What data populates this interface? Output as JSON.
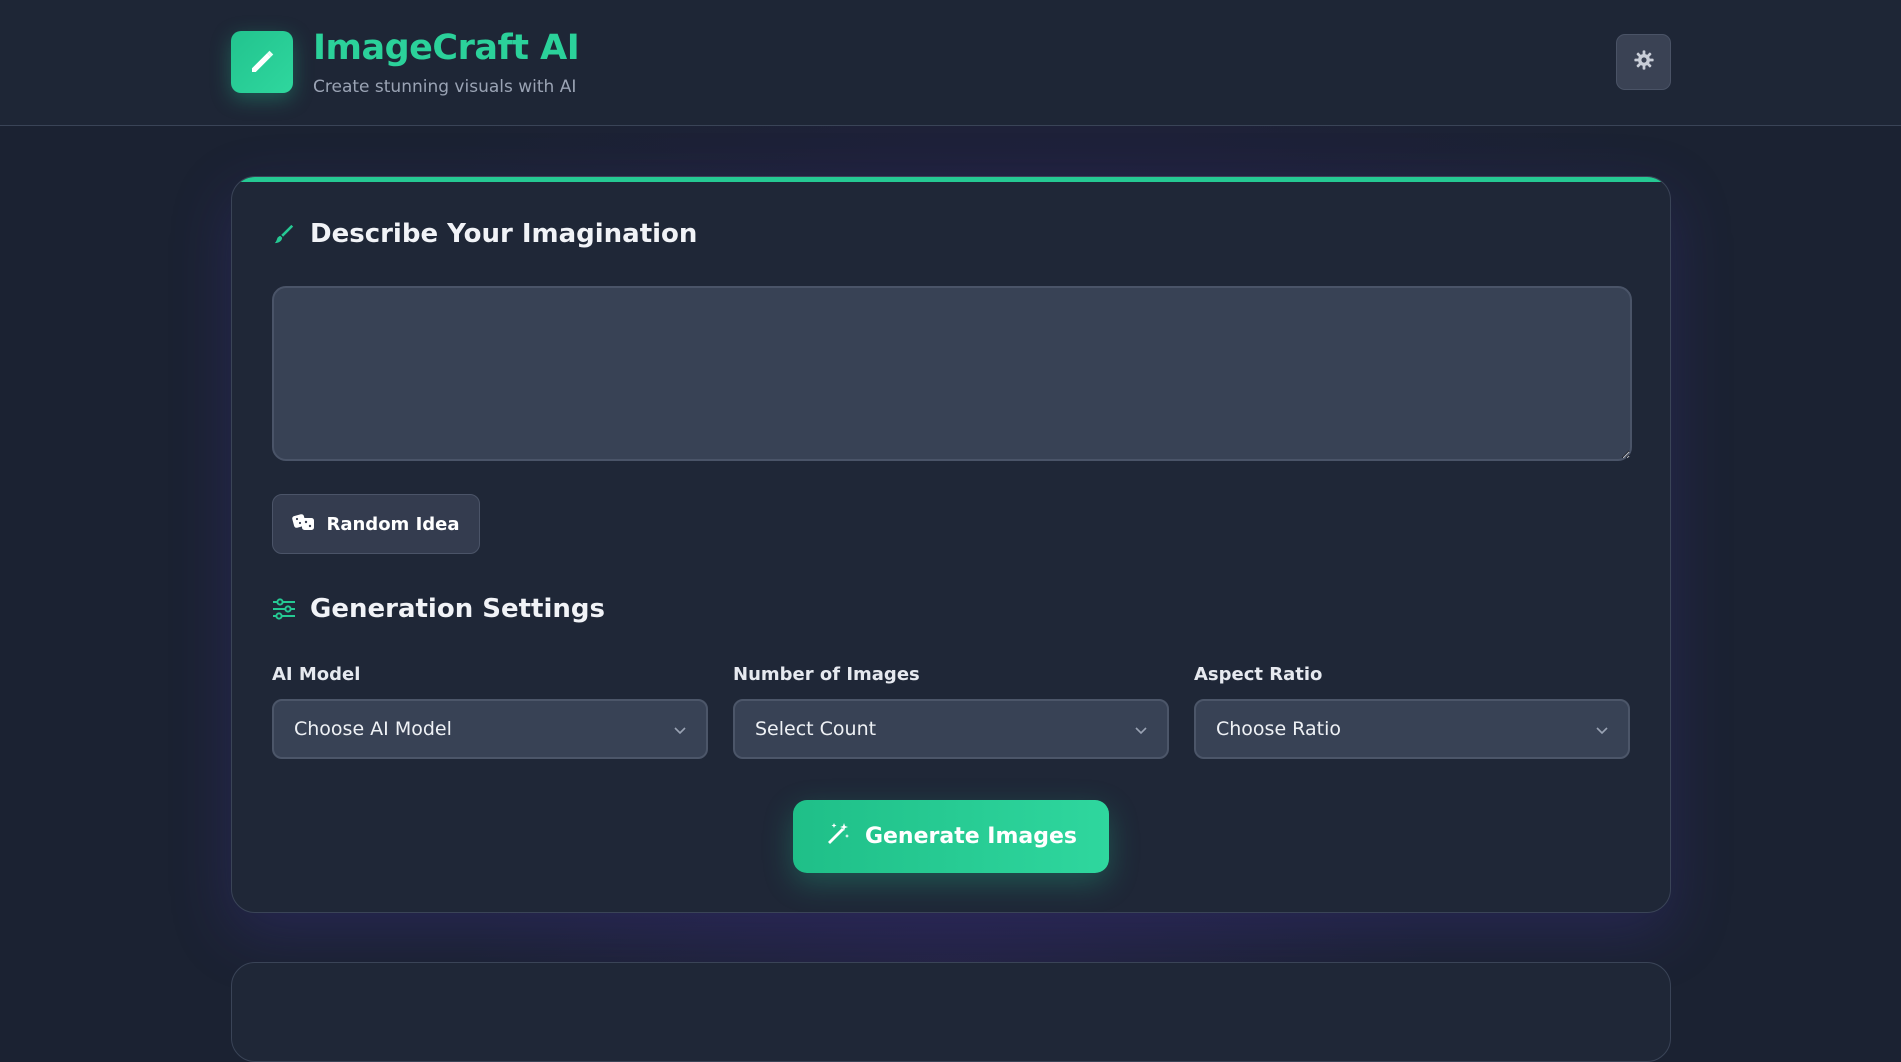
{
  "header": {
    "brand_title": "ImageCraft AI",
    "brand_subtitle": "Create stunning visuals with AI",
    "logo_icon": "brush-icon",
    "settings_icon": "gear-icon"
  },
  "prompt_section": {
    "title": "Describe Your Imagination",
    "icon": "paintbrush-icon",
    "textarea_value": "",
    "random_button_label": "Random Idea",
    "random_button_icon": "dice-icon"
  },
  "settings_section": {
    "title": "Generation Settings",
    "icon": "sliders-icon",
    "fields": [
      {
        "label": "AI Model",
        "selected": "Choose AI Model"
      },
      {
        "label": "Number of Images",
        "selected": "Select Count"
      },
      {
        "label": "Aspect Ratio",
        "selected": "Choose Ratio"
      }
    ]
  },
  "generate_button": {
    "label": "Generate Images",
    "icon": "magic-wand-icon"
  },
  "colors": {
    "accent": "#25c993",
    "background": "#1b2232",
    "card": "#1f2737",
    "input": "#384255"
  }
}
